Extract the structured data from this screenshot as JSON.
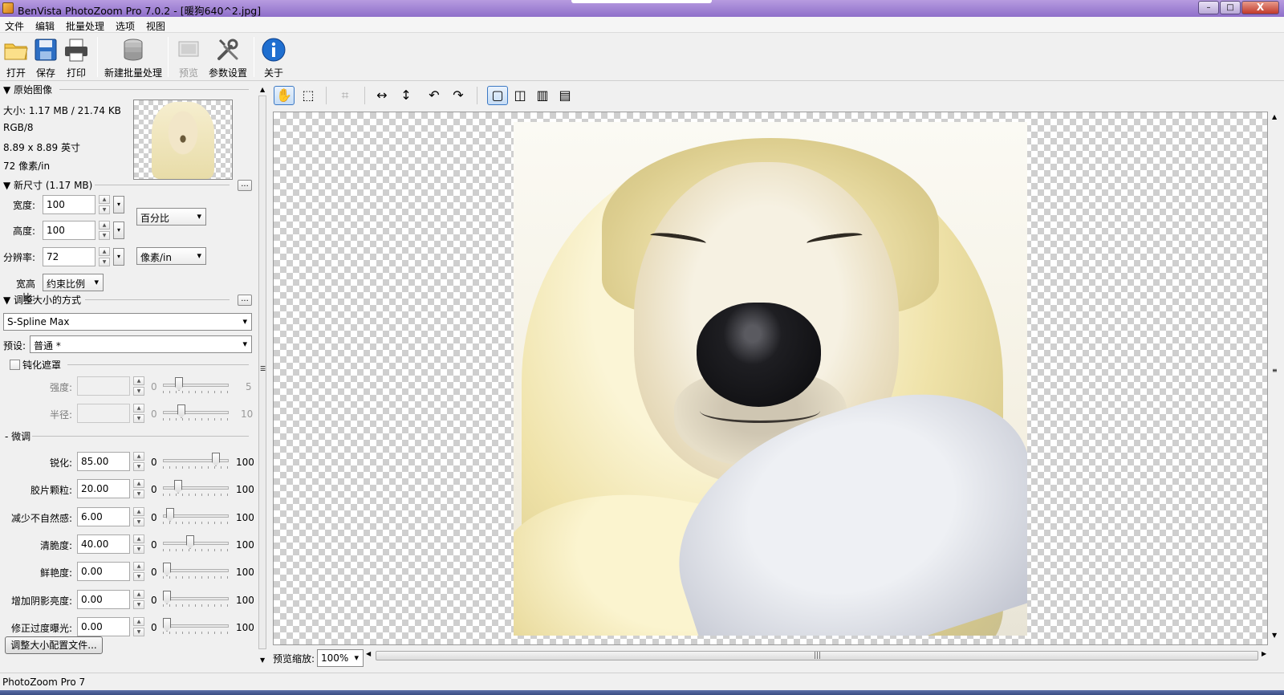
{
  "window": {
    "title": "BenVista PhotoZoom Pro 7.0.2 - [暖狗640^2.jpg]",
    "controls": {
      "minimize": "–",
      "maximize": "□",
      "close": "X"
    }
  },
  "menu": {
    "file": "文件",
    "edit": "编辑",
    "batch": "批量处理",
    "options": "选项",
    "view": "视图"
  },
  "toolbar": {
    "open": "打开",
    "save": "保存",
    "print": "打印",
    "new_batch": "新建批量处理",
    "preview": "预览",
    "settings": "参数设置",
    "about": "关于"
  },
  "original": {
    "header": "▼ 原始图像",
    "size": "大小: 1.17 MB / 21.74 KB",
    "mode": "RGB/8",
    "dimensions": "8.89 x 8.89 英寸",
    "resolution": "72 像素/in"
  },
  "new_size": {
    "header": "▼ 新尺寸 (1.17 MB)",
    "more": "...",
    "width_label": "宽度:",
    "width_value": "100",
    "height_label": "高度:",
    "height_value": "100",
    "res_label": "分辨率:",
    "res_value": "72",
    "unit_size": "百分比",
    "unit_res": "像素/in",
    "aspect_label": "宽高比:",
    "aspect_value": "约束比例"
  },
  "resize_method": {
    "header": "▼ 调整大小的方式",
    "more": "...",
    "method": "S-Spline Max",
    "preset_label": "预设:",
    "preset_value": "普通 *"
  },
  "unsharp": {
    "header": "钝化遮罩",
    "strength_label": "强度:",
    "strength_min": "0",
    "strength_max": "5",
    "radius_label": "半径:",
    "radius_min": "0",
    "radius_max": "10"
  },
  "fine_tune": {
    "header": "- 微调",
    "sliders": [
      {
        "label": "锐化:",
        "value": "85.00",
        "min": "0",
        "max": "100",
        "level": 85
      },
      {
        "label": "胶片颗粒:",
        "value": "20.00",
        "min": "0",
        "max": "100",
        "level": 20
      },
      {
        "label": "减少不自然感:",
        "value": "6.00",
        "min": "0",
        "max": "100",
        "level": 6
      },
      {
        "label": "清脆度:",
        "value": "40.00",
        "min": "0",
        "max": "100",
        "level": 40
      },
      {
        "label": "鲜艳度:",
        "value": "0.00",
        "min": "0",
        "max": "100",
        "level": 0
      },
      {
        "label": "增加阴影亮度:",
        "value": "0.00",
        "min": "0",
        "max": "100",
        "level": 0
      },
      {
        "label": "修正过度曝光:",
        "value": "0.00",
        "min": "0",
        "max": "100",
        "level": 0
      }
    ]
  },
  "profile_button": "调整大小配置文件...",
  "view_tools": {
    "hand": "✋",
    "select": "⬚",
    "crop": "⌗",
    "fit_width": "↔",
    "fit_height": "↕",
    "rotate_left": "↶",
    "rotate_right": "↷",
    "single": "▢",
    "split_v": "◫",
    "dual": "▥",
    "split_h": "▤"
  },
  "zoom": {
    "label": "预览缩放:",
    "value": "100%"
  },
  "status": "PhotoZoom Pro 7"
}
